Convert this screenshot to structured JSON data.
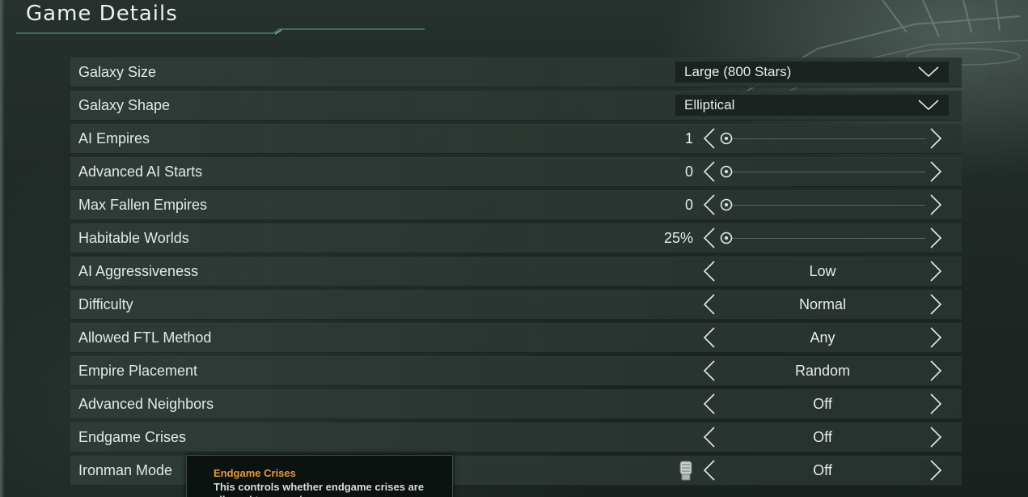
{
  "page": {
    "title": "Game Details"
  },
  "colors": {
    "row_bg": "#2f3c38",
    "dropdown_bg": "#1b2321",
    "tooltip_title": "#e09a3a",
    "text": "#e6e9e7"
  },
  "settings": [
    {
      "label": "Galaxy Size",
      "control": "dropdown",
      "value": "Large (800 Stars)",
      "icon": "chevron-down-icon"
    },
    {
      "label": "Galaxy Shape",
      "control": "dropdown",
      "value": "Elliptical",
      "icon": "chevron-down-icon"
    },
    {
      "label": "AI Empires",
      "control": "slider",
      "value": "1",
      "slider_fraction": 0
    },
    {
      "label": "Advanced AI Starts",
      "control": "slider",
      "value": "0",
      "slider_fraction": 0
    },
    {
      "label": "Max Fallen Empires",
      "control": "slider",
      "value": "0",
      "slider_fraction": 0
    },
    {
      "label": "Habitable Worlds",
      "control": "slider",
      "value": "25%",
      "slider_fraction": 0
    },
    {
      "label": "AI Aggressiveness",
      "control": "selector",
      "value": "Low"
    },
    {
      "label": "Difficulty",
      "control": "selector",
      "value": "Normal"
    },
    {
      "label": "Allowed FTL Method",
      "control": "selector",
      "value": "Any"
    },
    {
      "label": "Empire Placement",
      "control": "selector",
      "value": "Random"
    },
    {
      "label": "Advanced Neighbors",
      "control": "selector",
      "value": "Off"
    },
    {
      "label": "Endgame Crises",
      "control": "selector",
      "value": "Off"
    },
    {
      "label": "Ironman Mode",
      "control": "selector",
      "value": "Off",
      "icon": "ironman-fist-icon"
    }
  ],
  "tooltip": {
    "title": "Endgame Crises",
    "body": "This controls whether endgame crises are allowed to occur in"
  }
}
